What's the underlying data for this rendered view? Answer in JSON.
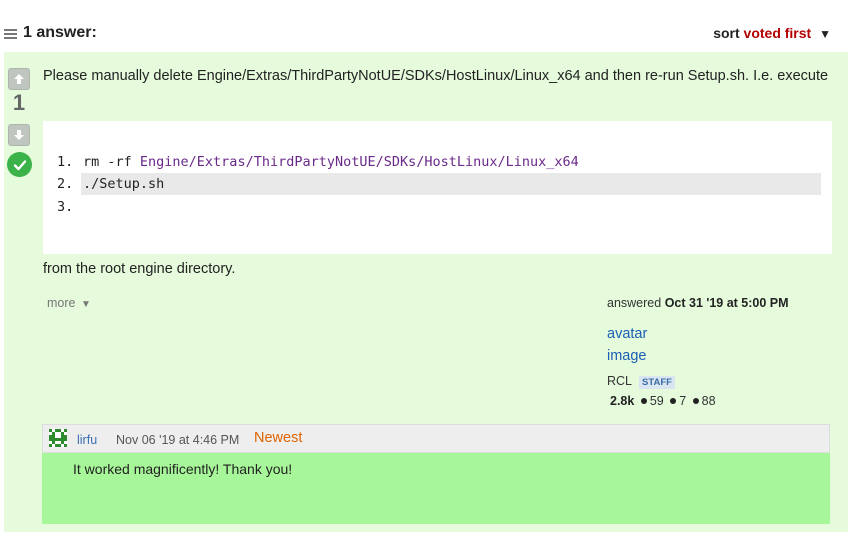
{
  "header": {
    "answers_count": "1 answer:",
    "sort_prefix": "sort",
    "sort_value": "voted first",
    "sort_caret": "▼"
  },
  "answer": {
    "vote_count": "1",
    "text": "Please manually delete Engine/Extras/ThirdPartyNotUE/SDKs/HostLinux/Linux_x64 and then re-run Setup.sh. I.e. execute",
    "code_lines": [
      {
        "num": "1.",
        "cmd": "rm -rf ",
        "path": "Engine/Extras/ThirdPartyNotUE/SDKs/HostLinux/Linux_x64"
      },
      {
        "num": "2.",
        "cmd": "./Setup.sh",
        "path": ""
      },
      {
        "num": "3.",
        "cmd": "",
        "path": ""
      }
    ],
    "after_text": "from the root engine directory.",
    "more_label": "more",
    "more_caret": "▼",
    "answered_label": "answered",
    "answered_date": "Oct 31 '19 at 5:00 PM",
    "avatar_line1": "avatar",
    "avatar_line2": "image",
    "user_name": "RCL",
    "user_badge": "STAFF",
    "reputation": "2.8k",
    "stat1": "59",
    "stat2": "7",
    "stat3": "88"
  },
  "comment": {
    "user": "lirfu",
    "date": "Nov 06 '19 at 4:46 PM",
    "newest_label": "Newest",
    "text": "It worked magnificently! Thank you!"
  },
  "icons": {
    "hamburger": "list-icon",
    "vote_up": "arrow-up-icon",
    "vote_down": "arrow-down-icon",
    "accepted": "checkmark-icon",
    "comment_avatar": "identicon-avatar"
  },
  "colors": {
    "answer_bg": "#e5fbdc",
    "comment_bg": "#a7f79a",
    "sort_accent": "#b40000",
    "newest": "#e06400",
    "accepted": "#3bb24a",
    "code_path": "#6a2a8a"
  }
}
